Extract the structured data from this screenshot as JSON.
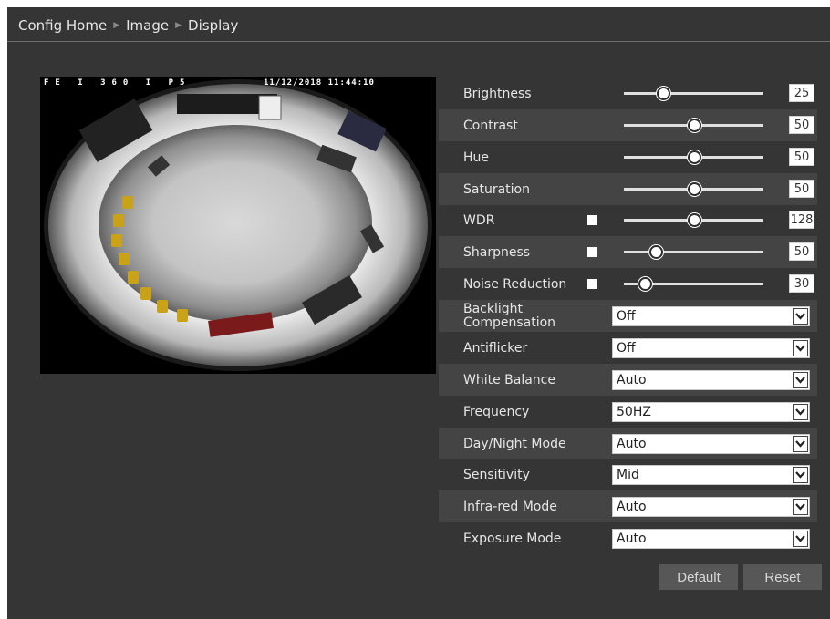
{
  "breadcrumb": {
    "home": "Config Home",
    "section": "Image",
    "page": "Display"
  },
  "video": {
    "model": "FE I 360 I P5",
    "timestamp": "11/12/2018 11:44:10"
  },
  "sliders": [
    {
      "label": "Brightness",
      "value": "25",
      "fraction": 0.25,
      "checkbox": false
    },
    {
      "label": "Contrast",
      "value": "50",
      "fraction": 0.5,
      "checkbox": false
    },
    {
      "label": "Hue",
      "value": "50",
      "fraction": 0.5,
      "checkbox": false
    },
    {
      "label": "Saturation",
      "value": "50",
      "fraction": 0.5,
      "checkbox": false
    },
    {
      "label": "WDR",
      "value": "128",
      "fraction": 0.5,
      "checkbox": true
    },
    {
      "label": "Sharpness",
      "value": "50",
      "fraction": 0.2,
      "checkbox": true
    },
    {
      "label": "Noise Reduction",
      "value": "30",
      "fraction": 0.12,
      "checkbox": true
    }
  ],
  "selects": [
    {
      "label": "Backlight Compensation",
      "label_line1": "Backlight",
      "label_line2": "Compensation",
      "value": "Off"
    },
    {
      "label": "Antiflicker",
      "value": "Off"
    },
    {
      "label": "White Balance",
      "value": "Auto"
    },
    {
      "label": "Frequency",
      "value": "50HZ"
    },
    {
      "label": "Day/Night Mode",
      "value": "Auto"
    },
    {
      "label": "Sensitivity",
      "value": "Mid"
    },
    {
      "label": "Infra-red Mode",
      "value": "Auto"
    },
    {
      "label": "Exposure Mode",
      "value": "Auto"
    }
  ],
  "buttons": {
    "default": "Default",
    "reset": "Reset"
  },
  "icons": {
    "dropdown": "chevron-down-icon",
    "breadcrumb_separator": "triangle-right-icon"
  }
}
